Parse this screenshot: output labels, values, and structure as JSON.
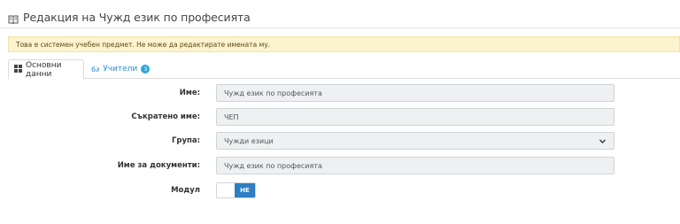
{
  "header": {
    "title": "Редакция на Чужд език по професията",
    "icon": "book-icon"
  },
  "alert": {
    "text": "Това е системен учебен предмет. Не може да редактирате имената му."
  },
  "tabs": [
    {
      "label": "Основни данни",
      "icon": "grid-icon",
      "active": true
    },
    {
      "label": "Учители",
      "icon": "teachers-icon",
      "badge": "3",
      "active": false
    }
  ],
  "form": {
    "name": {
      "label": "Име:",
      "value": "Чужд език по професията"
    },
    "short_name": {
      "label": "Съкратено име:",
      "value": "ЧЕП"
    },
    "group": {
      "label": "Група:",
      "value": "Чужди езици"
    },
    "doc_name": {
      "label": "Име за документи:",
      "value": "Чужд език по професията"
    },
    "module": {
      "label": "Модул",
      "toggle_state": "НЕ"
    }
  },
  "colors": {
    "accent": "#2e7ec2",
    "alert_bg": "#fcf3cf",
    "link": "#2d8bd0",
    "badge": "#2aa8d8"
  }
}
